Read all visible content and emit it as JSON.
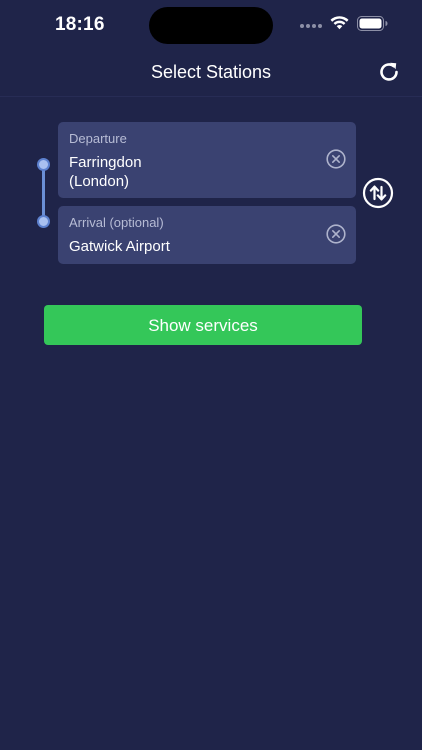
{
  "status_bar": {
    "time": "18:16"
  },
  "nav": {
    "title": "Select Stations",
    "refresh_icon": "refresh-icon"
  },
  "departure": {
    "label": "Departure",
    "value_line1": "Farringdon",
    "value_line2": "(London)",
    "clear_icon": "clear-icon"
  },
  "arrival": {
    "label": "Arrival (optional)",
    "value": "Gatwick Airport",
    "clear_icon": "clear-icon"
  },
  "swap": {
    "icon": "swap-stations-icon"
  },
  "actions": {
    "show_services_label": "Show services"
  },
  "colors": {
    "background": "#1f2449",
    "card": "#3a4271",
    "primary_button": "#34c759",
    "route_line": "#6b8fd6"
  }
}
